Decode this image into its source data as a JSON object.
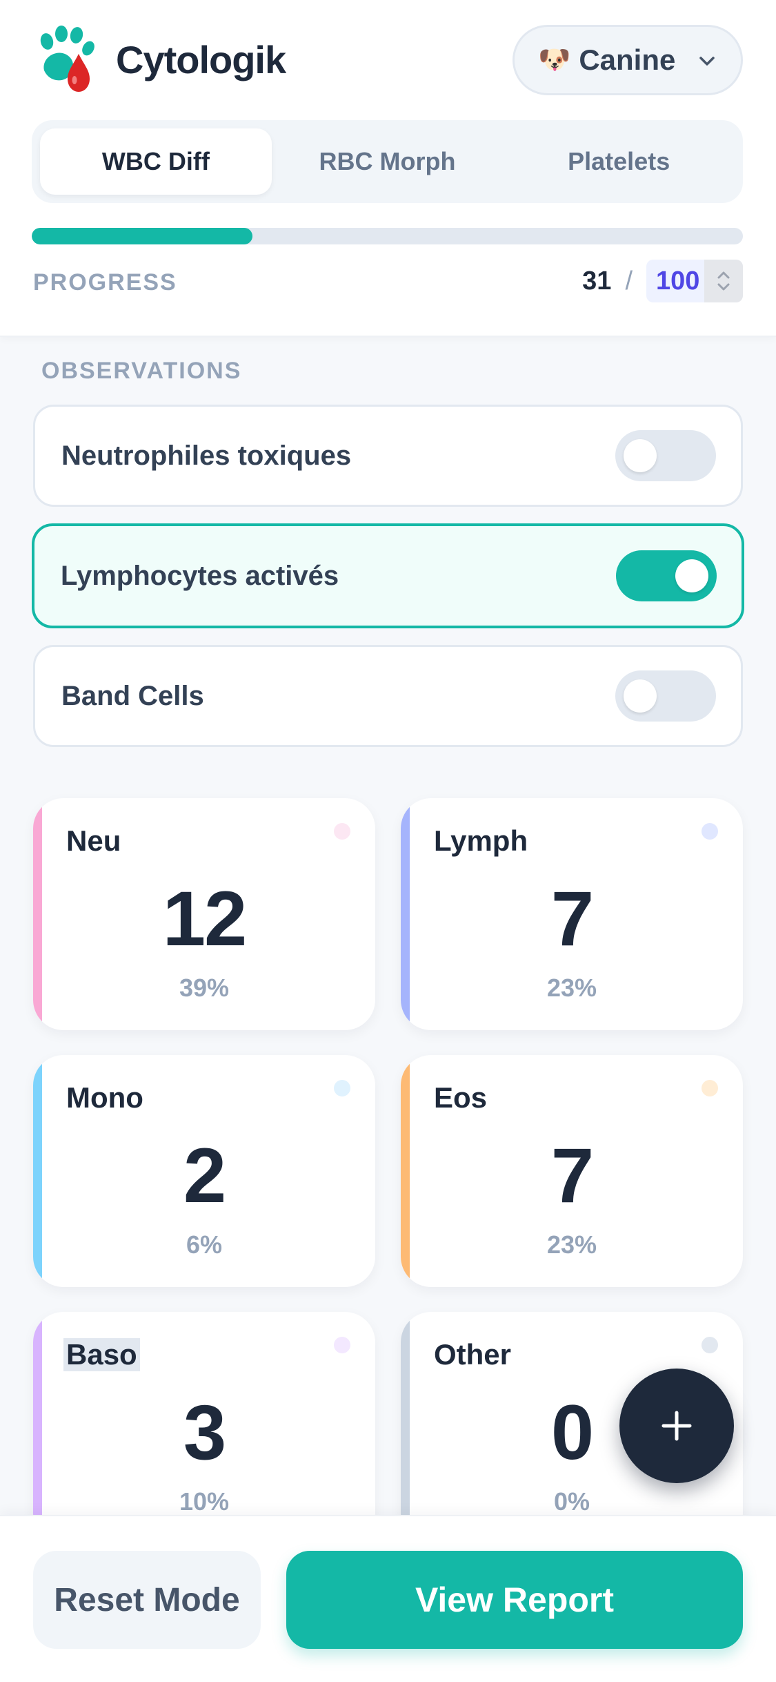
{
  "app": {
    "name": "Cytologik"
  },
  "species": {
    "label": "Canine",
    "icon": "dog-face-icon",
    "emoji": "🐶"
  },
  "tabs": [
    {
      "label": "WBC Diff",
      "active": true
    },
    {
      "label": "RBC Morph",
      "active": false
    },
    {
      "label": "Platelets",
      "active": false
    }
  ],
  "progress": {
    "label": "PROGRESS",
    "current": "31",
    "separator": "/",
    "target": "100",
    "fraction": 0.31
  },
  "observations": {
    "title": "OBSERVATIONS",
    "items": [
      {
        "label": "Neutrophiles toxiques",
        "on": false
      },
      {
        "label": "Lymphocytes activés",
        "on": true
      },
      {
        "label": "Band Cells",
        "on": false
      }
    ]
  },
  "cells": [
    {
      "name": "Neu",
      "count": "12",
      "percent": "39%",
      "color": "#f9a8d4",
      "dot": "#fce7f3"
    },
    {
      "name": "Lymph",
      "count": "7",
      "percent": "23%",
      "color": "#a5b4fc",
      "dot": "#e0e7ff"
    },
    {
      "name": "Mono",
      "count": "2",
      "percent": "6%",
      "color": "#7dd3fc",
      "dot": "#e0f2fe"
    },
    {
      "name": "Eos",
      "count": "7",
      "percent": "23%",
      "color": "#fdba74",
      "dot": "#ffedd5"
    },
    {
      "name": "Baso",
      "count": "3",
      "percent": "10%",
      "color": "#d8b4fe",
      "dot": "#f3e8ff"
    },
    {
      "name": "Other",
      "count": "0",
      "percent": "0%",
      "color": "#cbd5e1",
      "dot": "#e2e8f0"
    }
  ],
  "actions": {
    "reset": "Reset Mode",
    "report": "View Report",
    "add_icon": "plus-icon"
  },
  "colors": {
    "accent": "#14b8a6",
    "dark": "#1e293b",
    "target": "#4f46e5"
  }
}
